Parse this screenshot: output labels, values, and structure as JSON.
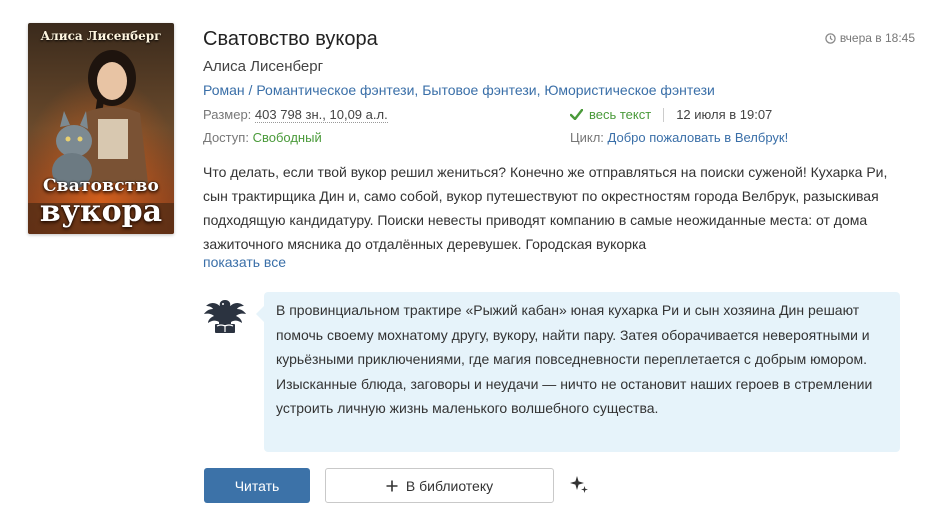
{
  "book": {
    "title": "Сватовство вукора",
    "author": "Алиса Лисенберг",
    "genres": [
      "Роман",
      "Романтическое фэнтези",
      "Бытовое фэнтези",
      "Юмористическое фэнтези"
    ],
    "genre_sep1": " / ",
    "genre_sep2": ", ",
    "genre_sep3": ", ",
    "date": "вчера в 18:45",
    "size_label": "Размер:",
    "size_value": "403 798 зн., 10,09 а.л.",
    "access_label": "Доступ:",
    "access_value": "Свободный",
    "fulltext_label": "весь текст",
    "fulltext_date": "12 июля в 19:07",
    "cycle_label": "Цикл:",
    "cycle_value": "Добро пожаловать в Велбрук!",
    "description": "Что делать, если твой вукор решил жениться? Конечно же отправляться на поиски суженой! Кухарка Ри, сын трактирщика Дин и, само собой, вукор путешествуют по окрестностям города Велбрук, разыскивая подходящую кандидатуру. Поиски невесты приводят компанию в самые неожиданные места: от дома зажиточного мясника до отдалённых деревушек. Городская вукорка",
    "show_all": "показать все",
    "annotation": "В провинциальном трактире «Рыжий кабан» юная кухарка Ри и сын хозяина Дин решают помочь своему мохнатому другу, вукору, найти пару. Затея оборачивается невероятными и курьёзными приключениями, где магия повседневности переплетается с добрым юмором. Изысканные блюда, заговоры и неудачи — ничто не остановит наших героев в стремлении устроить личную жизнь маленького волшебного существа."
  },
  "cover": {
    "author_text": "Алиса Лисенберг",
    "title_line1": "Сватовство",
    "title_line2": "вукора"
  },
  "actions": {
    "read_label": "Читать",
    "library_label": "В библиотеку"
  },
  "icons": {
    "clock": "clock-icon",
    "check": "check-icon",
    "annotation_logo": "eagle-book-icon",
    "plus": "plus-icon",
    "sparkle": "sparkle-icon"
  },
  "colors": {
    "link": "#3a6fa8",
    "access_green": "#4a9a3a",
    "read_button": "#3c72a8",
    "annotation_bg": "#e6f3fa"
  }
}
